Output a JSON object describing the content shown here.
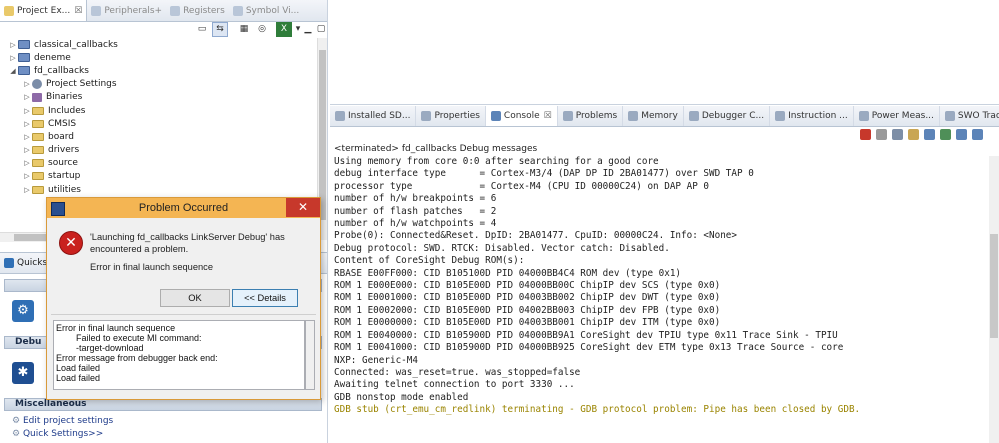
{
  "left_tabs": [
    {
      "label": "Project Ex...",
      "active": true
    },
    {
      "label": "Peripherals+",
      "active": false
    },
    {
      "label": "Registers",
      "active": false
    },
    {
      "label": "Symbol Vi...",
      "active": false
    }
  ],
  "tree": [
    {
      "label": "classical_callbacks",
      "kind": "project",
      "depth": 0,
      "twisty": "▷"
    },
    {
      "label": "deneme",
      "kind": "project",
      "depth": 0,
      "twisty": "▷"
    },
    {
      "label": "fd_callbacks",
      "kind": "project",
      "depth": 0,
      "twisty": "◢"
    },
    {
      "label": "Project Settings",
      "kind": "gear",
      "depth": 1,
      "twisty": "▷"
    },
    {
      "label": "Binaries",
      "kind": "bin",
      "depth": 1,
      "twisty": "▷"
    },
    {
      "label": "Includes",
      "kind": "folder",
      "depth": 1,
      "twisty": "▷"
    },
    {
      "label": "CMSIS",
      "kind": "folder",
      "depth": 1,
      "twisty": "▷"
    },
    {
      "label": "board",
      "kind": "folder",
      "depth": 1,
      "twisty": "▷"
    },
    {
      "label": "drivers",
      "kind": "folder",
      "depth": 1,
      "twisty": "▷"
    },
    {
      "label": "source",
      "kind": "folder",
      "depth": 1,
      "twisty": "▷"
    },
    {
      "label": "startup",
      "kind": "folder",
      "depth": 1,
      "twisty": "▷"
    },
    {
      "label": "utilities",
      "kind": "folder",
      "depth": 1,
      "twisty": "▷"
    }
  ],
  "quickstart": {
    "tab_label": "Quicks",
    "section_debug": "Debu",
    "section_misc": "Miscellaneous",
    "links": [
      "Edit project settings",
      "Quick Settings>>"
    ]
  },
  "right_tabs": [
    {
      "label": "Installed SD...",
      "active": false
    },
    {
      "label": "Properties",
      "active": false
    },
    {
      "label": "Console",
      "active": true,
      "close": "☒"
    },
    {
      "label": "Problems",
      "active": false
    },
    {
      "label": "Memory",
      "active": false
    },
    {
      "label": "Debugger C...",
      "active": false
    },
    {
      "label": "Instruction ...",
      "active": false
    },
    {
      "label": "Power Meas...",
      "active": false
    },
    {
      "label": "SWO Trace ...",
      "active": false
    }
  ],
  "console": {
    "header": "<terminated> fd_callbacks Debug messages",
    "lines": [
      "Using memory from core 0:0 after searching for a good core",
      "debug interface type      = Cortex-M3/4 (DAP DP ID 2BA01477) over SWD TAP 0",
      "processor type            = Cortex-M4 (CPU ID 00000C24) on DAP AP 0",
      "number of h/w breakpoints = 6",
      "number of flash patches   = 2",
      "number of h/w watchpoints = 4",
      "Probe(0): Connected&Reset. DpID: 2BA01477. CpuID: 00000C24. Info: <None>",
      "Debug protocol: SWD. RTCK: Disabled. Vector catch: Disabled.",
      "Content of CoreSight Debug ROM(s):",
      "RBASE E00FF000: CID B105100D PID 04000BB4C4 ROM dev (type 0x1)",
      "ROM 1 E000E000: CID B105E00D PID 04000BB00C ChipIP dev SCS (type 0x0)",
      "ROM 1 E0001000: CID B105E00D PID 04003BB002 ChipIP dev DWT (type 0x0)",
      "ROM 1 E0002000: CID B105E00D PID 04002BB003 ChipIP dev FPB (type 0x0)",
      "ROM 1 E0000000: CID B105E00D PID 04003BB001 ChipIP dev ITM (type 0x0)",
      "ROM 1 E0040000: CID B105900D PID 04000BB9A1 CoreSight dev TPIU type 0x11 Trace Sink - TPIU",
      "ROM 1 E0041000: CID B105900D PID 04000BB925 CoreSight dev ETM type 0x13 Trace Source - core",
      "NXP: Generic-M4",
      "Connected: was_reset=true. was_stopped=false",
      "Awaiting telnet connection to port 3330 ...",
      "GDB nonstop mode enabled"
    ],
    "error_line": "GDB stub (crt_emu_cm_redlink) terminating - GDB protocol problem: Pipe has been closed by GDB."
  },
  "dialog": {
    "title": "Problem Occurred",
    "close_glyph": "✕",
    "error_glyph": "✕",
    "message": "'Launching fd_callbacks LinkServer Debug' has encountered a problem.",
    "sub_message": "Error in final launch sequence",
    "ok_label": "OK",
    "details_label": "<< Details",
    "details_text": "Error in final launch sequence\n        Failed to execute MI command:\n        -target-download\nError message from debugger back end:\nLoad failed\nLoad failed"
  },
  "colors": {
    "dialog_title": "#f4b553",
    "close_button": "#c7382b",
    "error_icon": "#c9211e",
    "console_error": "#9a8400",
    "link": "#1e3b8a"
  }
}
